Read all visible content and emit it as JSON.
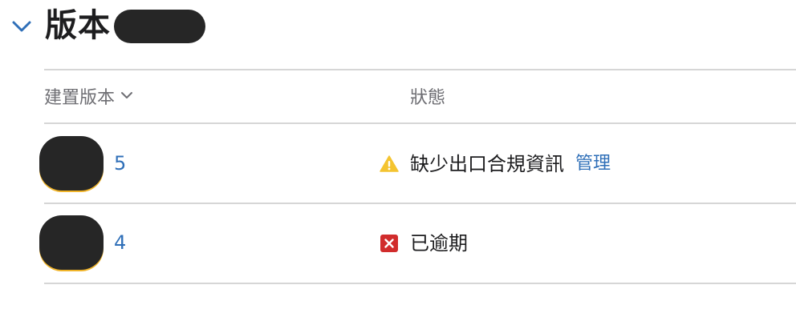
{
  "section": {
    "title": "版本",
    "toggle_icon": "chevron-down-icon"
  },
  "table": {
    "headers": {
      "build": "建置版本",
      "status": "狀態"
    },
    "rows": [
      {
        "build_number": "5",
        "status_text": "缺少出口合規資訊",
        "status_icon": "warning-triangle-icon",
        "status_color": "#f4c430",
        "action_label": "管理"
      },
      {
        "build_number": "4",
        "status_text": "已逾期",
        "status_icon": "expired-x-icon",
        "status_color": "#d12c2c"
      }
    ]
  },
  "colors": {
    "link": "#2f6fb8",
    "chevron": "#2f6fb8",
    "divider": "#d6d6d6",
    "header_text": "#6e6e73"
  }
}
